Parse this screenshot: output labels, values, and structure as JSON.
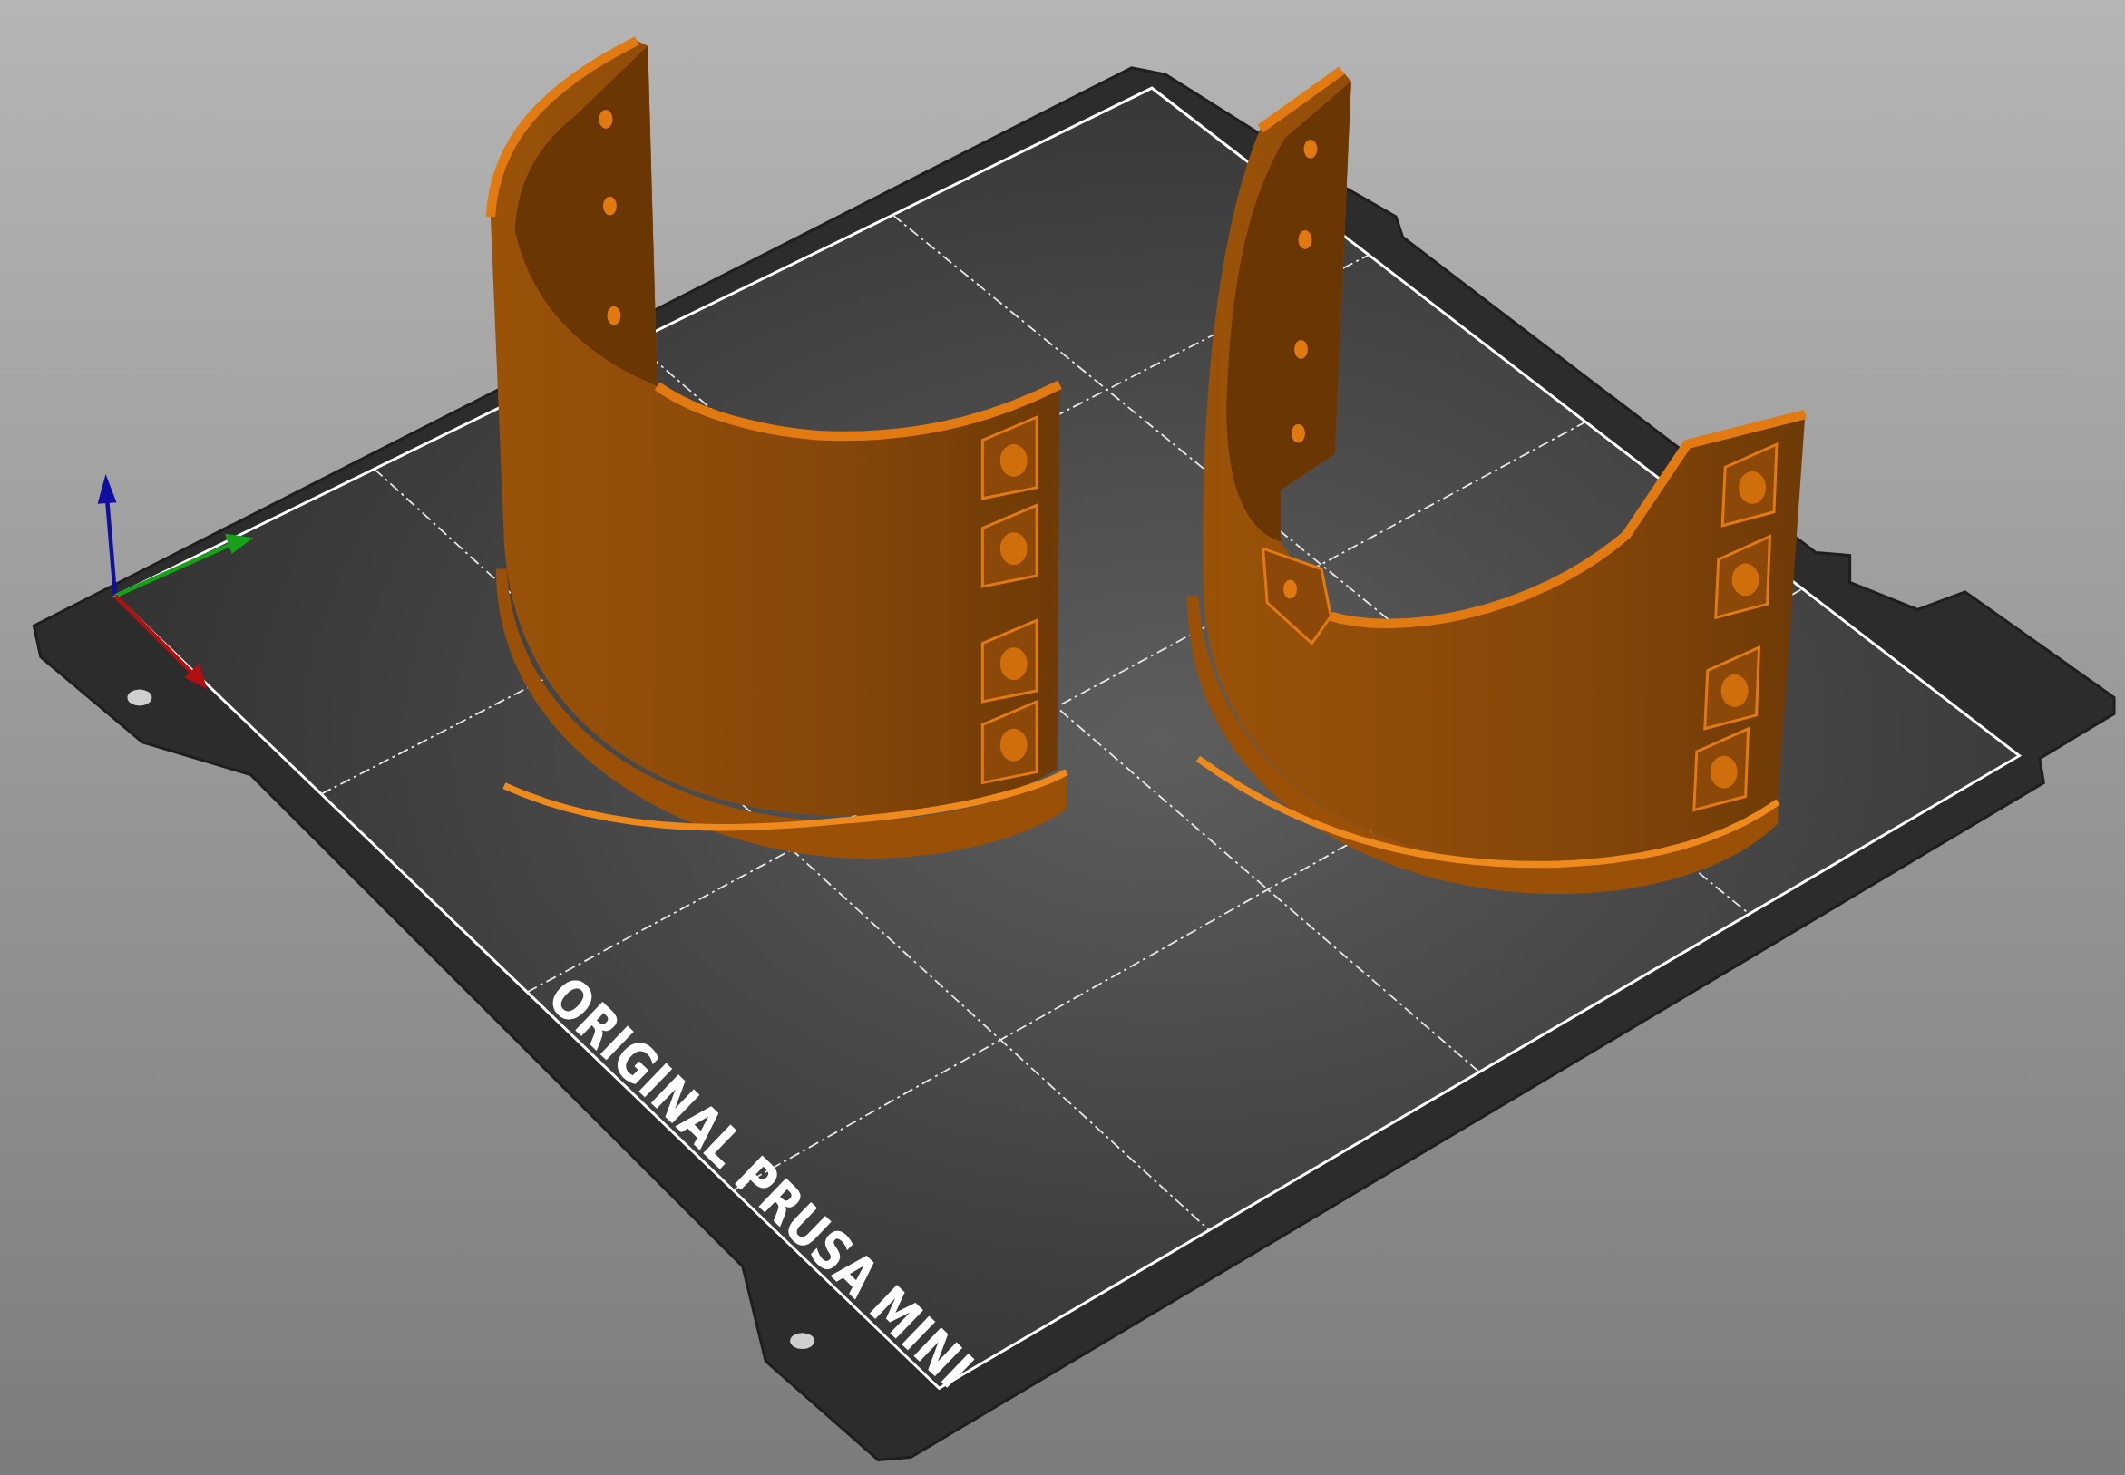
{
  "viewport": {
    "bed_label": "ORIGINAL PRUSA MINI"
  }
}
